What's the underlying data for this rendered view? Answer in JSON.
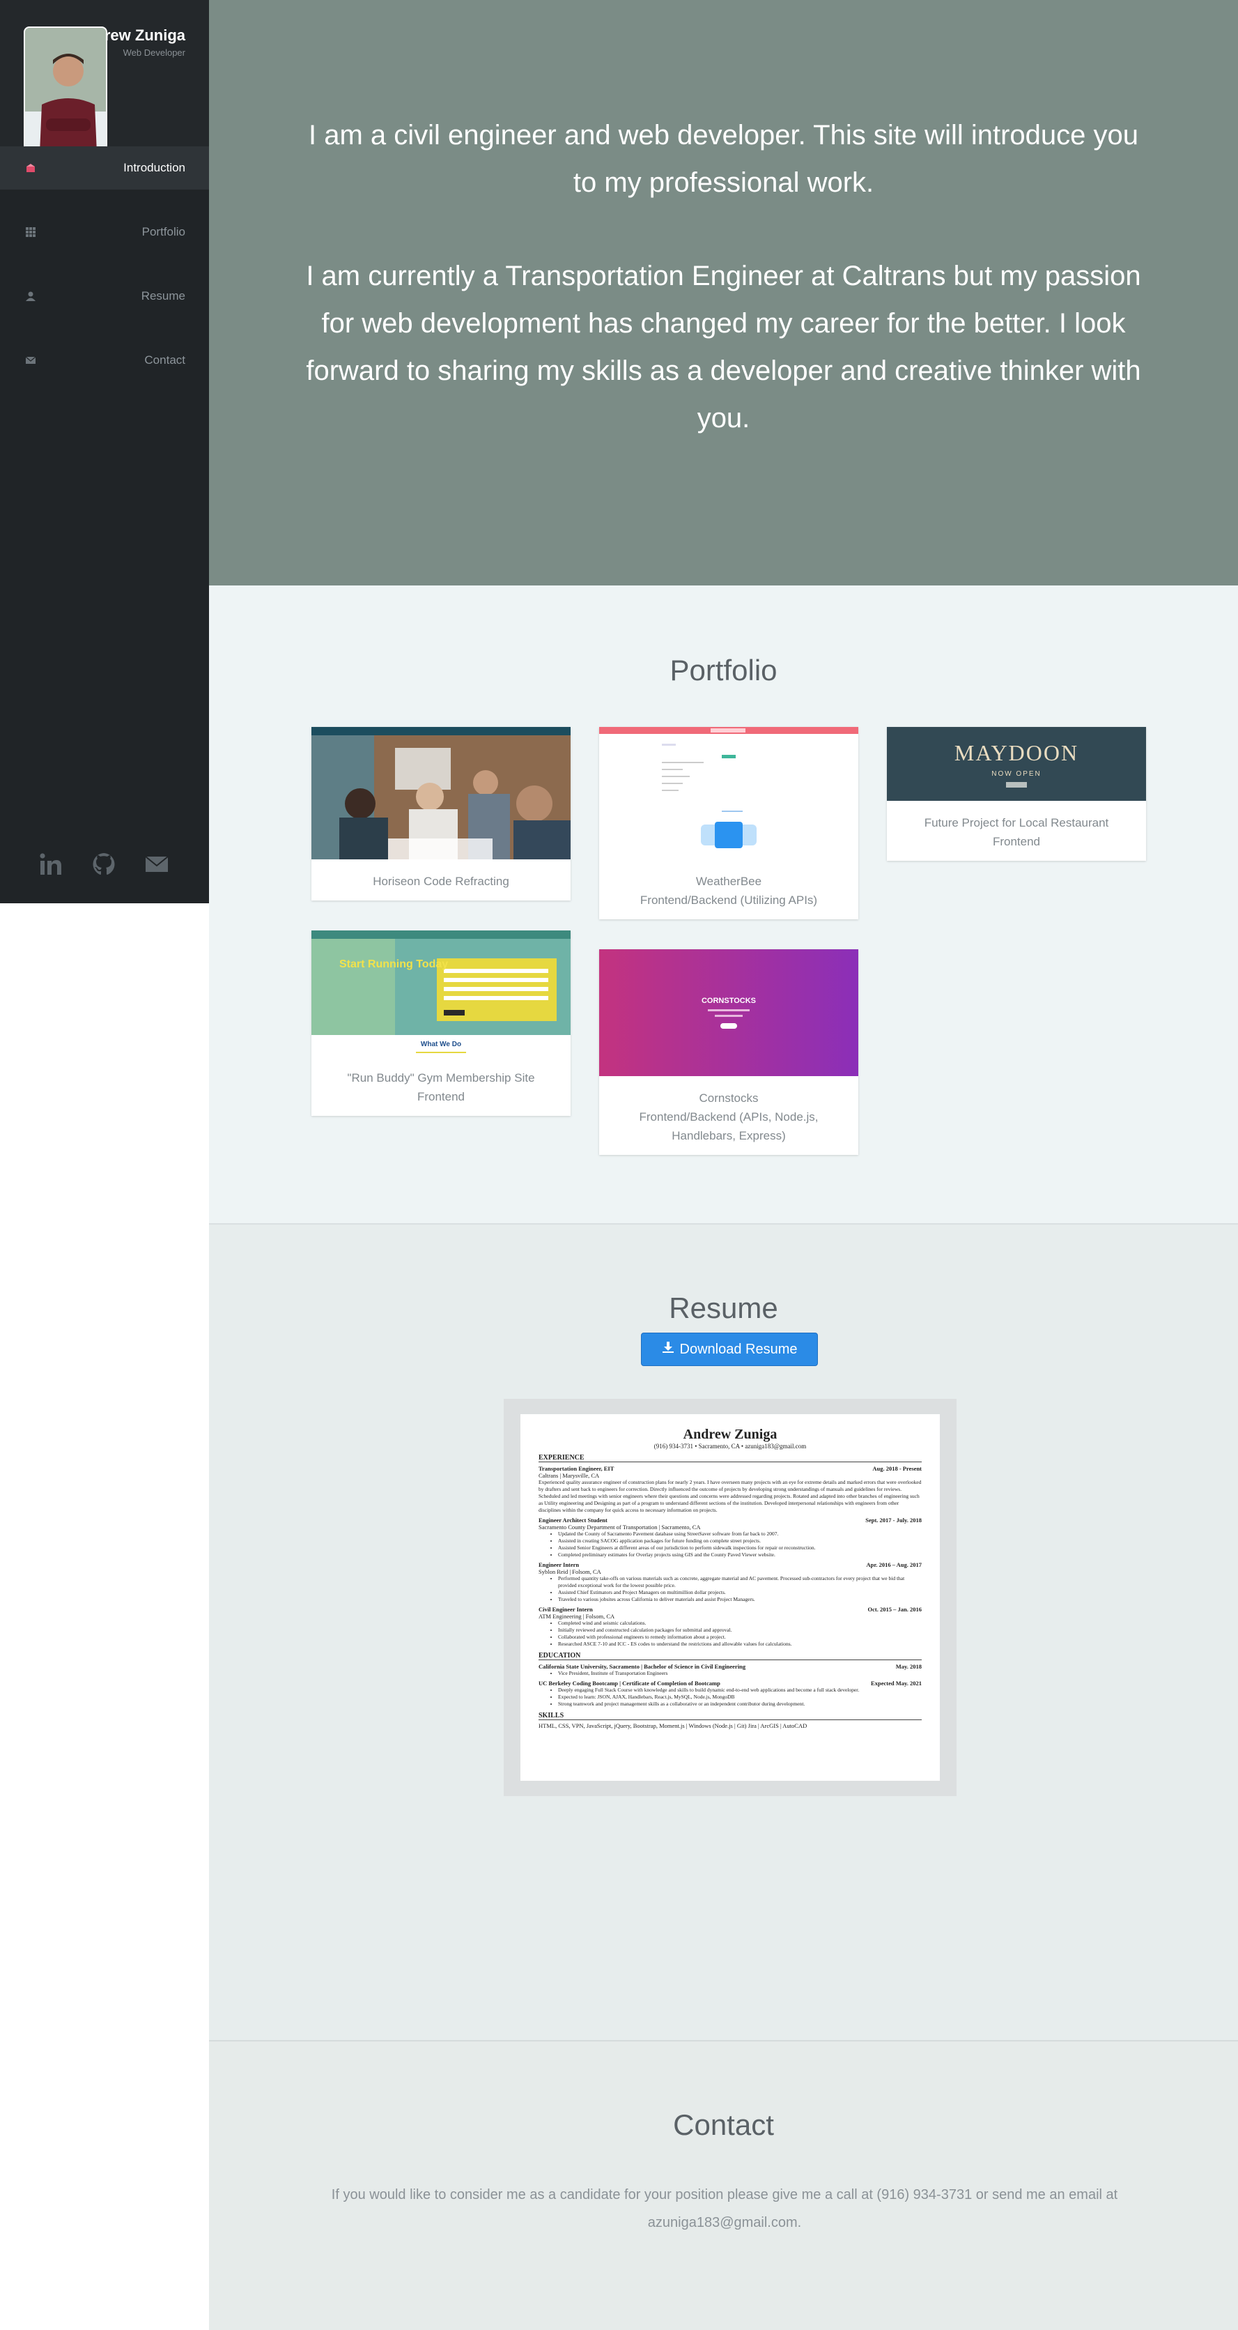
{
  "sidebar": {
    "name": "Andrew Zuniga",
    "title": "Web Developer",
    "nav": [
      {
        "label": "Introduction",
        "icon": "flag-icon"
      },
      {
        "label": "Portfolio",
        "icon": "grid-icon"
      },
      {
        "label": "Resume",
        "icon": "user-icon"
      },
      {
        "label": "Contact",
        "icon": "envelope-icon"
      }
    ],
    "social": [
      "linkedin-icon",
      "github-icon",
      "envelope-icon"
    ]
  },
  "intro": {
    "p1": "I am a civil engineer and web developer. This site will introduce you to my professional work.",
    "p2": "I am currently a Transportation Engineer at Caltrans but my passion for web development has changed my career for the better. I look forward to sharing my skills as a developer and creative thinker with you."
  },
  "portfolio": {
    "title": "Portfolio",
    "items": [
      {
        "line1": "Horiseon Code Refracting",
        "line2": ""
      },
      {
        "line1": "WeatherBee",
        "line2": "Frontend/Backend (Utilizing APIs)"
      },
      {
        "line1": "Future Project for Local Restaurant",
        "line2": "Frontend"
      },
      {
        "line1": "\"Run Buddy\" Gym Membership Site",
        "line2": "Frontend"
      },
      {
        "line1": "Cornstocks",
        "line2": "Frontend/Backend (APIs, Node.js, Handlebars, Express)"
      }
    ],
    "thumbs": {
      "maydoon": "MAYDOON",
      "maydoon_sub": "NOW OPEN",
      "runbuddy": "Start Running Today",
      "runbuddy_what": "What We Do",
      "cornstocks": "CORNSTOCKS"
    }
  },
  "resume": {
    "title": "Resume",
    "button": "Download Resume",
    "doc": {
      "name": "Andrew Zuniga",
      "contact": "(916) 934-3731 • Sacramento, CA • azuniga183@gmail.com",
      "experience_h": "EXPERIENCE",
      "jobs": [
        {
          "title": "Transportation Engineer, EIT",
          "date": "Aug. 2018 - Present",
          "org": "Caltrans | Marysville, CA",
          "desc": "Experienced quality assurance engineer of construction plans for nearly 2 years. I have overseen many projects with an eye for extreme details and marked errors that were overlooked by drafters and sent back to engineers for correction. Directly influenced the outcome of projects by developing strong understandings of manuals and guidelines for reviews. Scheduled and led meetings with senior engineers where their questions and concerns were addressed regarding projects. Rotated and adapted into other branches of engineering such as Utility engineering and Designing as part of a program to understand different sections of the institution. Developed interpersonal relationships with engineers from other disciplines within the company for quick access to necessary information on projects."
        },
        {
          "title": "Engineer Architect Student",
          "date": "Sept. 2017 - July. 2018",
          "org": "Sacramento County Department of Transportation | Sacramento, CA",
          "bullets": [
            "Updated the County of Sacramento Pavement database using StreetSaver software from far back to 2007.",
            "Assisted in creating SACOG application packages for future funding on complete street projects.",
            "Assisted Senior Engineers at different areas of our jurisdiction to perform sidewalk inspections for repair or reconstruction.",
            "Completed preliminary estimates for Overlay projects using GIS and the County Paved Viewer website."
          ]
        },
        {
          "title": "Engineer Intern",
          "date": "Apr. 2016 – Aug. 2017",
          "org": "Syblon Reid | Folsom, CA",
          "bullets": [
            "Performed quantity take-offs on various materials such as concrete, aggregate material and AC pavement. Processed sub-contractors for every project that we bid that provided exceptional work for the lowest possible price.",
            "Assisted Chief Estimators and Project Managers on multimillion dollar projects.",
            "Traveled to various jobsites across California to deliver materials and assist Project Managers."
          ]
        },
        {
          "title": "Civil Engineer Intern",
          "date": "Oct. 2015 – Jan. 2016",
          "org": "ATM Engineering | Folsom, CA",
          "bullets": [
            "Completed wind and seismic calculations.",
            "Initially reviewed and constructed calculation packages for submittal and approval.",
            "Collaborated with professional engineers to remedy information about a project.",
            "Researched ASCE 7-10 and ICC - ES codes to understand the restrictions and allowable values for calculations."
          ]
        }
      ],
      "education_h": "EDUCATION",
      "edu": [
        {
          "title": "California State University, Sacramento | Bachelor of Science in Civil Engineering",
          "date": "May. 2018",
          "bullets": [
            "Vice President, Institute of Transportation Engineers"
          ]
        },
        {
          "title": "UC Berkeley Coding Bootcamp | Certificate of Completion of Bootcamp",
          "date": "Expected May. 2021",
          "bullets": [
            "Deeply engaging Full Stack Course with knowledge and skills to build dynamic end-to-end web applications and become a full stack developer.",
            "Expected to learn: JSON, AJAX, Handlebars, React.js, MySQL, Node.js, MongoDB",
            "Strong teamwork and project management skills as a collaborative or an independent contributor during development."
          ]
        }
      ],
      "skills_h": "SKILLS",
      "skills": "HTML, CSS, VPN, JavaScript, jQuery, Bootstrap, Moment.js | Windows (Node.js | Git) Jira | ArcGIS | AutoCAD"
    }
  },
  "contact": {
    "title": "Contact",
    "text": "If you would like to consider me as a candidate for your position please give me a call at (916) 934-3731 or send me an email at azuniga183@gmail.com."
  }
}
